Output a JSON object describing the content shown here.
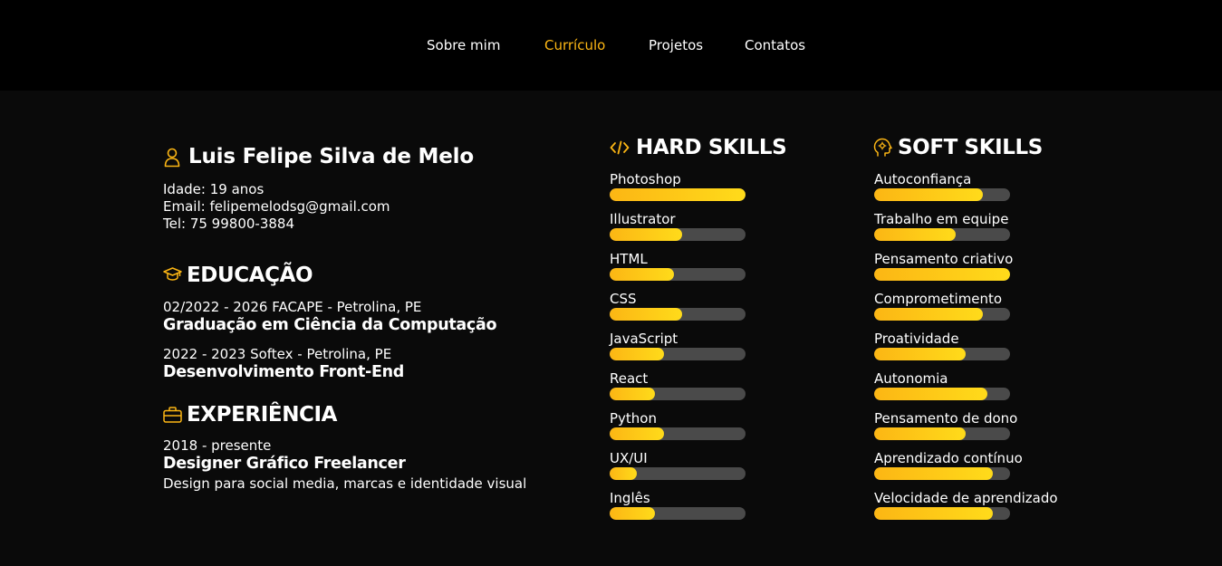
{
  "nav": {
    "items": [
      {
        "label": "Sobre mim",
        "active": false
      },
      {
        "label": "Currículo",
        "active": true
      },
      {
        "label": "Projetos",
        "active": false
      },
      {
        "label": "Contatos",
        "active": false
      }
    ]
  },
  "profile": {
    "name": "Luis Felipe Silva de Melo",
    "age": "Idade: 19 anos",
    "email": "Email: felipemelodsg@gmail.com",
    "phone": "Tel: 75 99800-3884"
  },
  "education": {
    "title": "EDUCAÇÃO",
    "entries": [
      {
        "meta": "02/2022 - 2026 FACAPE - Petrolina, PE",
        "degree": "Graduação em Ciência da Computação"
      },
      {
        "meta": "2022 - 2023 Softex - Petrolina, PE",
        "degree": "Desenvolvimento Front-End"
      }
    ]
  },
  "experience": {
    "title": "EXPERIÊNCIA",
    "entries": [
      {
        "meta": "2018 - presente",
        "role": "Designer Gráfico Freelancer",
        "description": "Design para social media, marcas e identidade visual"
      }
    ]
  },
  "hard_skills": {
    "title": "HARD SKILLS",
    "items": [
      {
        "label": "Photoshop",
        "level": 1.0
      },
      {
        "label": "Illustrator",
        "level": 0.53
      },
      {
        "label": "HTML",
        "level": 0.47
      },
      {
        "label": "CSS",
        "level": 0.53
      },
      {
        "label": "JavaScript",
        "level": 0.4
      },
      {
        "label": "React",
        "level": 0.33
      },
      {
        "label": "Python",
        "level": 0.4
      },
      {
        "label": "UX/UI",
        "level": 0.2
      },
      {
        "label": "Inglês",
        "level": 0.33
      }
    ]
  },
  "soft_skills": {
    "title": "SOFT SKILLS",
    "items": [
      {
        "label": "Autoconfiança",
        "level": 0.8
      },
      {
        "label": "Trabalho em equipe",
        "level": 0.6
      },
      {
        "label": "Pensamento criativo",
        "level": 1.0
      },
      {
        "label": "Comprometimento",
        "level": 0.8
      },
      {
        "label": "Proatividade",
        "level": 0.67
      },
      {
        "label": "Autonomia",
        "level": 0.83
      },
      {
        "label": "Pensamento de dono",
        "level": 0.67
      },
      {
        "label": "Aprendizado contínuo",
        "level": 0.87
      },
      {
        "label": "Velocidade de aprendizado",
        "level": 0.87
      }
    ]
  },
  "colors": {
    "accent": "#fcb614",
    "accent_light": "#ffdb1a",
    "track": "#4a4a4a",
    "background": "#0a0a0a",
    "nav_background": "#000000"
  },
  "icons": {
    "name": "user-icon",
    "education": "graduation-cap-icon",
    "experience": "briefcase-icon",
    "hard_skills": "code-icon",
    "soft_skills": "brain-icon"
  }
}
